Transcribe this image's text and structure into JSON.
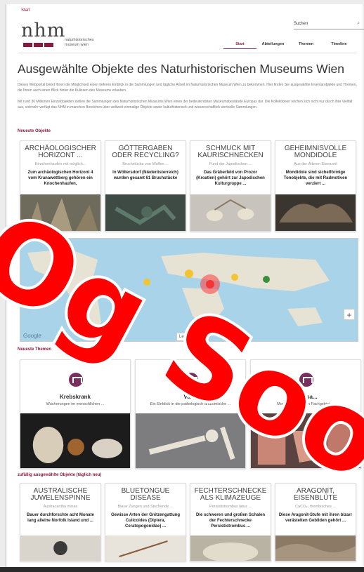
{
  "breadcrumb": "Start",
  "logo": {
    "letters": "nhm",
    "subtitle_line1": "naturhistorisches",
    "subtitle_line2": "museum wien"
  },
  "search": {
    "label": "Suchen"
  },
  "nav": [
    "Start",
    "Abteilungen",
    "Themen",
    "Timeline"
  ],
  "page_title": "Ausgewählte Objekte des Naturhistorischen Museums Wien",
  "intro": [
    "Dieses Webportal bietet Ihnen die Möglichkeit einen tieferen Einblick in die Sammlungen und tägliche Arbeit im Naturhistorischen Museum Wien zu bekommen. Hier finden Sie ausgewählte Inventarobjekte und Themen, die Ihnen auch einen Blick hinter die Kulissen des Museums erlauben.",
    "Mit rund 30 Millionen Einzelobjekten stellen die Sammlungen des Naturhistorischen Museums Wien einen der bedeutendsten Museumsbestände Europas dar. Die Kollektionen reichen sich nicht nur durch ihre Vielfalt aus, vielmehr verfügt das NHM in manchen Bereichen über weltweit einmalige Objekte sowie kulturhistorisch und wissenschaftlich wertvolle Sammlungen."
  ],
  "newest_objects": {
    "title": "Neueste Objekte",
    "cards": [
      {
        "title": "Archäologischer Horizont ...",
        "subtitle": "Knochenhaufen mit möglich...",
        "desc": "Zum archäologischen Horizont 4 vom Kranawettberg gehören ein Knochenhaufen,",
        "img": "a"
      },
      {
        "title": "Göttergaben oder Recycling?",
        "subtitle": "Bruchstücke von Waffen ...",
        "desc": "In Wöllersdorf (Niederösterreich) wurden gesamt 61 Bruchstücke",
        "img": "b"
      },
      {
        "title": "Schmuck mit Kaurischnecken",
        "subtitle": "Fund der Japodischen ...",
        "desc": "Das Gräberfeld von Prozor (Kroatien) gehört zur Japodischen Kulturgruppe ...",
        "img": "c"
      },
      {
        "title": "Geheimnisvolle Mondidole",
        "subtitle": "Aus der Älteren Eisenzeit",
        "desc": "Mondidole sind sichelförmige Tonobjekte, die mit Radmotiven verziert ...",
        "img": "d"
      }
    ]
  },
  "map": {
    "provider": "Google",
    "legend": "Legende",
    "zoom_in": "+"
  },
  "newest_topics": {
    "title": "Neueste Themen",
    "topics": [
      {
        "title": "Krebskrank",
        "subtitle": "Wucherungen im menschlichen ..."
      },
      {
        "title": "Varia",
        "subtitle": "Ein Einblick in die pathologisch-anatomische ..."
      },
      {
        "title": "Hautsa...",
        "subtitle": "Moulagen aus dem Fachgebiet ..."
      }
    ]
  },
  "random_objects": {
    "title": "zufällig ausgewählte Objekte (täglich neu)",
    "cards": [
      {
        "title": "Australische Juwelenspinne",
        "subtitle": "Austracantha minax",
        "desc": "Bauer durchforschte acht Monate lang alleine Norfolk Island und ...",
        "img": "e"
      },
      {
        "title": "Bluetongue Disease",
        "subtitle": "Blaue Zungen und Stechende ...",
        "desc": "Gewisse Arten der Gnitzengattung Culicoides (Diptera, Ceratopogonidae) ...",
        "img": "f"
      },
      {
        "title": "Fechterschnecke als Klimazeuge",
        "subtitle": "Persististrombus latus ...",
        "desc": "Die schweren und großen Schalen der Fechterschnecke Persististrombus ...",
        "img": "g"
      },
      {
        "title": "Aragonit, Eisenblüte",
        "subtitle": "CaCO₃, rhombisches ...",
        "desc": "Diese Aragonit-Stufe mit ihren bizarr verästelten Gebilden gehört ...",
        "img": "h"
      }
    ]
  },
  "overlay_text": "Og Soo",
  "colors": {
    "brand": "#8b1a3a",
    "overlay": "#ff0000",
    "map_water": "#a9d3e8"
  }
}
